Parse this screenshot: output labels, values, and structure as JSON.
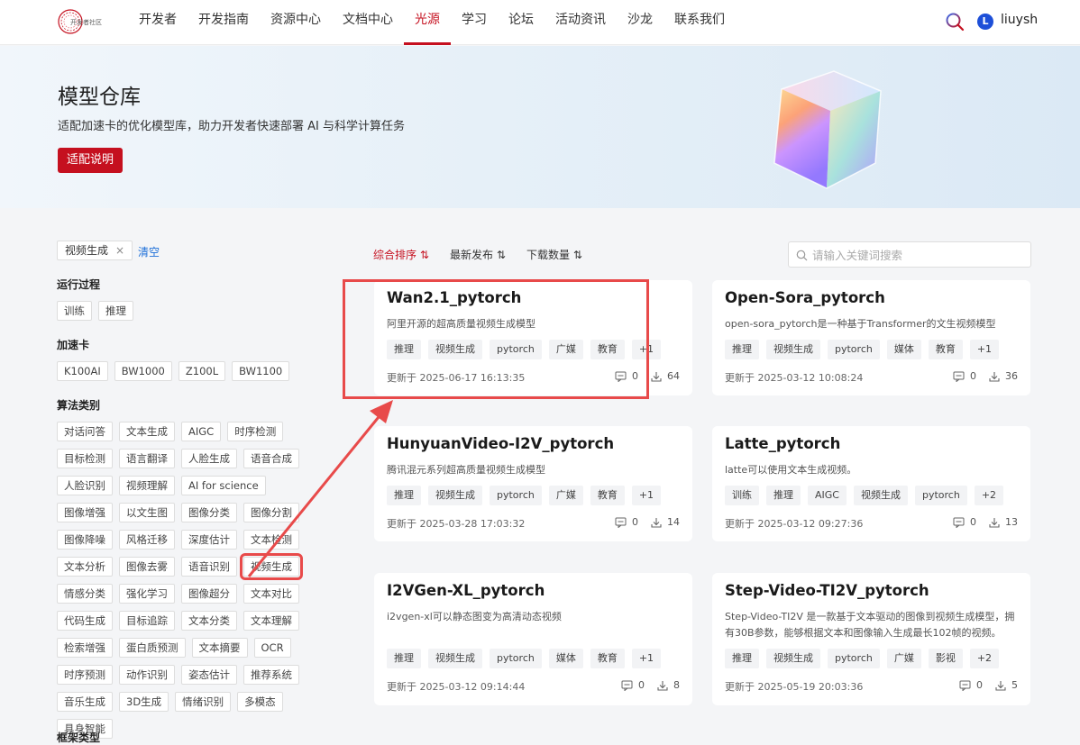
{
  "header": {
    "logo_text": "开发者社区",
    "nav": [
      "开发者",
      "开发指南",
      "资源中心",
      "文档中心",
      "光源",
      "学习",
      "论坛",
      "活动资讯",
      "沙龙",
      "联系我们"
    ],
    "active_nav": "光源",
    "avatar_letter": "L",
    "username": "liuysh"
  },
  "banner": {
    "title": "模型仓库",
    "subtitle": "适配加速卡的优化模型库，助力开发者快速部署 AI 与科学计算任务",
    "button": "适配说明"
  },
  "filters": {
    "selected": "视频生成",
    "close": "×",
    "clear": "清空",
    "groups": [
      {
        "title": "运行过程",
        "items": [
          "训练",
          "推理"
        ]
      },
      {
        "title": "加速卡",
        "items": [
          "K100AI",
          "BW1000",
          "Z100L",
          "BW1100"
        ]
      },
      {
        "title": "算法类别",
        "items": [
          "对话问答",
          "文本生成",
          "AIGC",
          "时序检测",
          "目标检测",
          "语言翻译",
          "人脸生成",
          "语音合成",
          "人脸识别",
          "视频理解",
          "AI for science",
          "图像增强",
          "以文生图",
          "图像分类",
          "图像分割",
          "图像降噪",
          "风格迁移",
          "深度估计",
          "文本检测",
          "文本分析",
          "图像去雾",
          "语音识别",
          "视频生成",
          "情感分类",
          "强化学习",
          "图像超分",
          "文本对比",
          "代码生成",
          "目标追踪",
          "文本分类",
          "文本理解",
          "检索增强",
          "蛋白质预测",
          "文本摘要",
          "OCR",
          "时序预测",
          "动作识别",
          "姿态估计",
          "推荐系统",
          "音乐生成",
          "3D生成",
          "情绪识别",
          "多模态",
          "具身智能"
        ]
      },
      {
        "title": "框架类型",
        "items": []
      }
    ]
  },
  "sort": {
    "options": [
      "综合排序",
      "最新发布",
      "下载数量"
    ],
    "active": "综合排序",
    "search_placeholder": "请输入关键词搜索"
  },
  "cards": [
    {
      "title": "Wan2.1_pytorch",
      "desc": "阿里开源的超高质量视频生成模型",
      "tags": [
        "推理",
        "视频生成",
        "pytorch",
        "广媒",
        "教育",
        "+1"
      ],
      "updated": "更新于 2025-06-17 16:13:35",
      "comments": "0",
      "downloads": "64"
    },
    {
      "title": "Open-Sora_pytorch",
      "desc": "open-sora_pytorch是一种基于Transformer的文生视频模型",
      "tags": [
        "推理",
        "视频生成",
        "pytorch",
        "媒体",
        "教育",
        "+1"
      ],
      "updated": "更新于 2025-03-12 10:08:24",
      "comments": "0",
      "downloads": "36"
    },
    {
      "title": "HunyuanVideo-I2V_pytorch",
      "desc": "腾讯混元系列超高质量视频生成模型",
      "tags": [
        "推理",
        "视频生成",
        "pytorch",
        "广媒",
        "教育",
        "+1"
      ],
      "updated": "更新于 2025-03-28 17:03:32",
      "comments": "0",
      "downloads": "14"
    },
    {
      "title": "Latte_pytorch",
      "desc": "latte可以使用文本生成视频。",
      "tags": [
        "训练",
        "推理",
        "AIGC",
        "视频生成",
        "pytorch",
        "+2"
      ],
      "updated": "更新于 2025-03-12 09:27:36",
      "comments": "0",
      "downloads": "13"
    },
    {
      "title": "I2VGen-XL_pytorch",
      "desc": "i2vgen-xl可以静态图变为高清动态视频",
      "tags": [
        "推理",
        "视频生成",
        "pytorch",
        "媒体",
        "教育",
        "+1"
      ],
      "updated": "更新于 2025-03-12 09:14:44",
      "comments": "0",
      "downloads": "8"
    },
    {
      "title": "Step-Video-TI2V_pytorch",
      "desc": "Step-Video-TI2V 是一款基于文本驱动的图像到视频生成模型，拥有30B参数，能够根据文本和图像输入生成最长102帧的视频。",
      "tags": [
        "推理",
        "视频生成",
        "pytorch",
        "广媒",
        "影视",
        "+2"
      ],
      "updated": "更新于 2025-05-19 20:03:36",
      "comments": "0",
      "downloads": "5"
    }
  ],
  "colors": {
    "accent": "#c5101f",
    "link": "#1d6fd8",
    "annotation": "#e84a4a"
  }
}
